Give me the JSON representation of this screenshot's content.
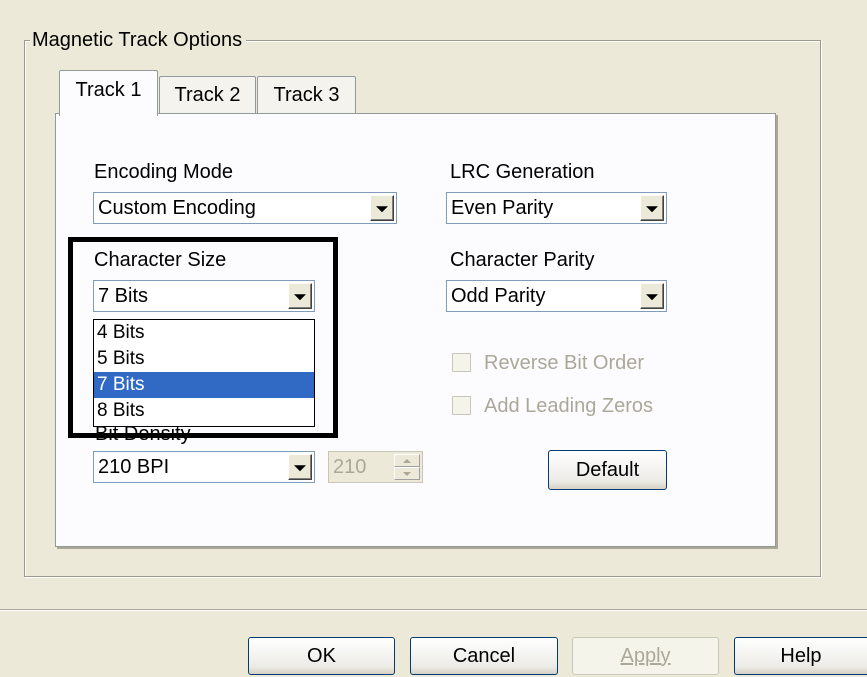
{
  "group": {
    "title": "Magnetic Track Options"
  },
  "tabs": [
    {
      "label": "Track 1",
      "active": true
    },
    {
      "label": "Track 2",
      "active": false
    },
    {
      "label": "Track 3",
      "active": false
    }
  ],
  "encoding_mode": {
    "label": "Encoding Mode",
    "value": "Custom Encoding"
  },
  "lrc_generation": {
    "label": "LRC Generation",
    "value": "Even Parity"
  },
  "character_size": {
    "label": "Character Size",
    "value": "7 Bits",
    "options": [
      "4 Bits",
      "5 Bits",
      "7 Bits",
      "8 Bits"
    ],
    "selected_index": 2
  },
  "character_parity": {
    "label": "Character Parity",
    "value": "Odd Parity"
  },
  "checkboxes": {
    "reverse_bit_order": {
      "label": "Reverse Bit Order",
      "checked": false,
      "enabled": false
    },
    "add_leading_zeros": {
      "label": "Add Leading Zeros",
      "checked": false,
      "enabled": false
    }
  },
  "bit_density": {
    "label": "Bit Density",
    "value": "210 BPI",
    "spin_value": "210"
  },
  "buttons": {
    "default": "Default",
    "ok": "OK",
    "cancel": "Cancel",
    "apply": "Apply",
    "help": "Help"
  },
  "colors": {
    "dialog_bg": "#ece9d8",
    "selection": "#316ac5",
    "disabled_text": "#aca899",
    "button_border": "#003c74"
  }
}
